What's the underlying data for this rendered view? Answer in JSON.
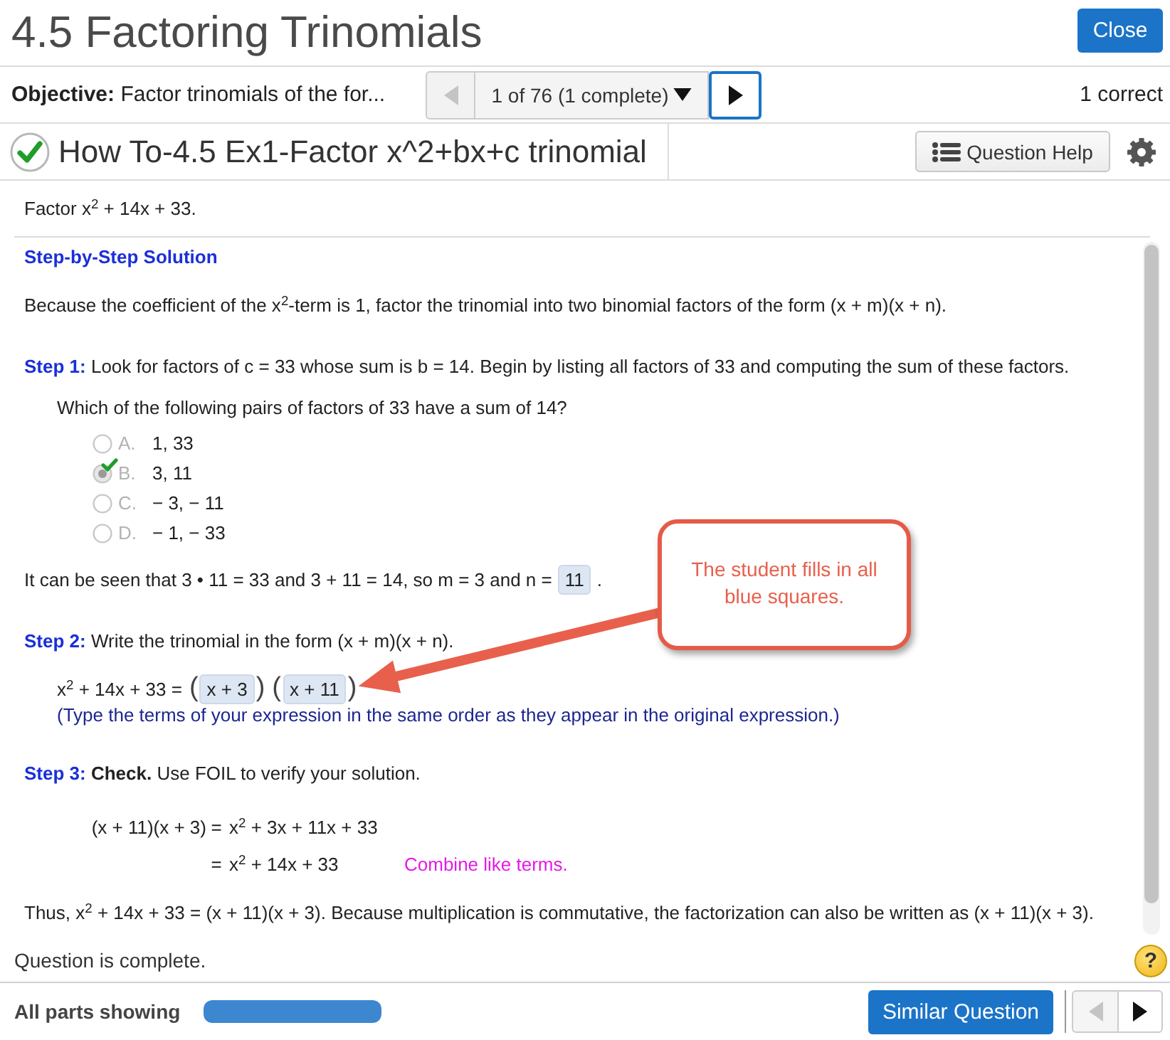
{
  "header": {
    "title": "4.5 Factoring Trinomials",
    "close_button": "Close"
  },
  "objective_bar": {
    "label": "Objective:",
    "text": "Factor trinomials of the for...",
    "prev_disabled": true,
    "position": "1 of 76 (1 complete)",
    "next_focused": true,
    "score": "1 correct"
  },
  "question_bar": {
    "complete": true,
    "title": "How To-4.5 Ex1-Factor x^2+bx+c trinomial",
    "help_button": "Question Help"
  },
  "problem": "Factor x$^{2}$ + 14x + 33.",
  "solution": [
    {
      "kind": "heading",
      "text": "Step-by-Step Solution"
    },
    {
      "kind": "paragraph",
      "text": "Because the coefficient of the x$^{2}$-term is 1, factor the trinomial into two binomial factors of the form (x + m)(x + n)."
    },
    {
      "kind": "step",
      "label": "Step 1:",
      "text": "Look for factors of c = 33 whose sum is b = 14. Begin by listing all factors of 33 and computing the sum of these factors."
    },
    {
      "kind": "question",
      "text": "Which of the following pairs of factors of 33 have a sum of 14?"
    },
    {
      "kind": "choices",
      "options": [
        {
          "letter": "A.",
          "value": "1, 33",
          "selected": false,
          "correct": false
        },
        {
          "letter": "B.",
          "value": "3, 11",
          "selected": true,
          "correct": true
        },
        {
          "letter": "C.",
          "value": "− 3, − 11",
          "selected": false,
          "correct": false
        },
        {
          "letter": "D.",
          "value": "− 1, − 33",
          "selected": false,
          "correct": false
        }
      ]
    },
    {
      "kind": "answer_line",
      "before": "It can be seen that 3 • 11 = 33 and 3 + 11 = 14, so m = 3 and n =",
      "answer": "11",
      "after": "."
    },
    {
      "kind": "step",
      "label": "Step 2:",
      "text": "Write the trinomial in the form (x + m)(x + n)."
    },
    {
      "kind": "equation",
      "lhs": "x$^{2}$ + 14x + 33 =",
      "factors": [
        {
          "open": "(",
          "answer": "x + 3",
          "close": ")"
        },
        {
          "open": "(",
          "answer": "x + 11",
          "close": ")"
        }
      ]
    },
    {
      "kind": "note",
      "text": "(Type the terms of your expression in the same order as they appear in the original expression.)"
    },
    {
      "kind": "step",
      "label": "Step 3:",
      "text": "**Check.** Use FOIL to verify your solution."
    },
    {
      "kind": "derivation",
      "lines": [
        {
          "lhs": "(x + 11)(x + 3)",
          "relation": "=",
          "rhs": "x$^{2}$ + 3x + 11x + 33"
        },
        {
          "relation": "=",
          "rhs": "x$^{2}$ + 14x + 33",
          "comment": "Combine like terms."
        }
      ]
    },
    {
      "kind": "paragraph",
      "text": "Thus, x$^{2}$ + 14x + 33 = (x + 11)(x + 3). Because multiplication is commutative, the factorization can also be written as (x + 11)(x + 3)."
    }
  ],
  "annotation": {
    "text": "The student fills in all blue squares."
  },
  "status": {
    "text": "Question is complete.",
    "help_glyph": "?"
  },
  "footer": {
    "label": "All parts showing",
    "progress": {
      "level": 1
    },
    "similar_button": "Similar Question",
    "prev_disabled": true,
    "next_disabled": false
  }
}
